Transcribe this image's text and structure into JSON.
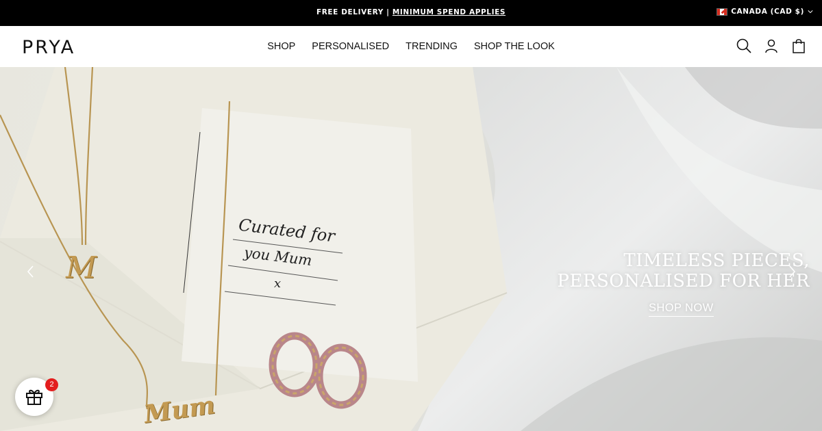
{
  "announcement": {
    "text": "FREE DELIVERY |",
    "link": "MINIMUM SPEND APPLIES",
    "country": "CANADA (CAD $)"
  },
  "header": {
    "logo": "PRYA",
    "nav": [
      "SHOP",
      "PERSONALISED",
      "TRENDING",
      "SHOP THE LOOK"
    ],
    "icons": [
      "search-icon",
      "account-icon",
      "cart-icon"
    ]
  },
  "hero": {
    "title_line1": "TIMELESS PIECES,",
    "title_line2": "PERSONALISED FOR HER",
    "cta": "SHOP NOW",
    "card_line1": "Curated for",
    "card_line2": "you Mum",
    "card_line3": "x",
    "pendant_letter": "M",
    "nameplate": "Mum"
  },
  "gift_widget": {
    "badge_count": "2"
  },
  "colors": {
    "announcement_bg": "#000000",
    "badge": "#e31d1d"
  }
}
